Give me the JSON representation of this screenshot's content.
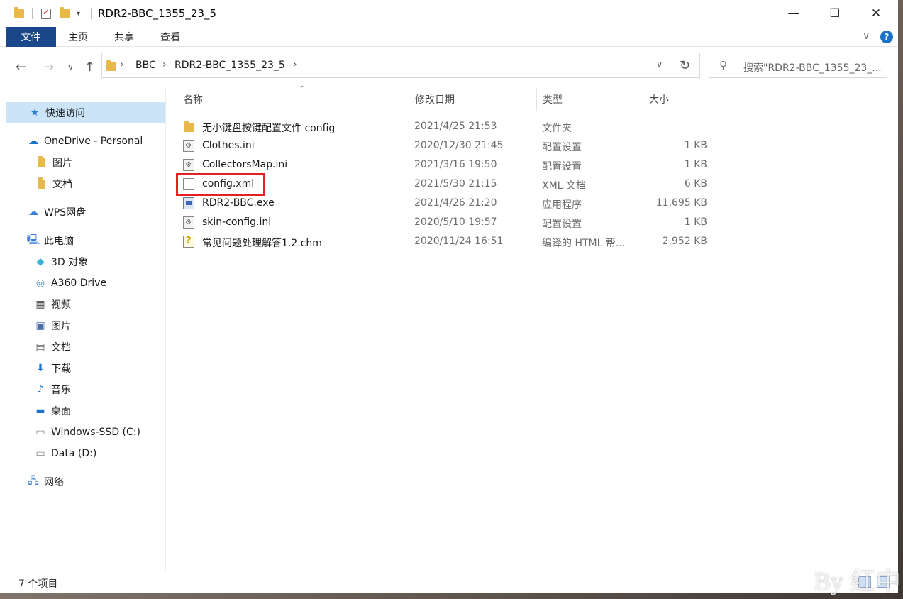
{
  "window": {
    "title": "RDR2-BBC_1355_23_5"
  },
  "ribbon": {
    "tabs": [
      "文件",
      "主页",
      "共享",
      "查看"
    ]
  },
  "address": {
    "crumbs": [
      "BBC",
      "RDR2-BBC_1355_23_5"
    ]
  },
  "search": {
    "placeholder": "搜索\"RDR2-BBC_1355_23_..."
  },
  "sidebar": {
    "items": [
      {
        "label": "快速访问",
        "icon": "star-icon"
      },
      {
        "label": "OneDrive - Personal",
        "icon": "cloud-icon"
      },
      {
        "label": "图片",
        "icon": "folder-icon"
      },
      {
        "label": "文档",
        "icon": "folder-icon"
      },
      {
        "label": "WPS网盘",
        "icon": "cloud-icon"
      },
      {
        "label": "此电脑",
        "icon": "computer-icon"
      },
      {
        "label": "3D 对象",
        "icon": "cube-icon"
      },
      {
        "label": "A360 Drive",
        "icon": "drive-icon"
      },
      {
        "label": "视频",
        "icon": "film-icon"
      },
      {
        "label": "图片",
        "icon": "picture-icon"
      },
      {
        "label": "文档",
        "icon": "document-icon"
      },
      {
        "label": "下载",
        "icon": "download-icon"
      },
      {
        "label": "音乐",
        "icon": "music-icon"
      },
      {
        "label": "桌面",
        "icon": "desktop-icon"
      },
      {
        "label": "Windows-SSD (C:)",
        "icon": "disk-icon"
      },
      {
        "label": "Data (D:)",
        "icon": "disk-icon"
      },
      {
        "label": "网络",
        "icon": "network-icon"
      }
    ]
  },
  "columns": {
    "name": "名称",
    "date": "修改日期",
    "type": "类型",
    "size": "大小"
  },
  "files": [
    {
      "name": "无小键盘按键配置文件 config",
      "date": "2021/4/25 21:53",
      "type": "文件夹",
      "size": "",
      "icon": "folder-icon"
    },
    {
      "name": "Clothes.ini",
      "date": "2020/12/30 21:45",
      "type": "配置设置",
      "size": "1 KB",
      "icon": "ini-file-icon"
    },
    {
      "name": "CollectorsMap.ini",
      "date": "2021/3/16 19:50",
      "type": "配置设置",
      "size": "1 KB",
      "icon": "ini-file-icon"
    },
    {
      "name": "config.xml",
      "date": "2021/5/30 21:15",
      "type": "XML 文档",
      "size": "6 KB",
      "icon": "xml-file-icon"
    },
    {
      "name": "RDR2-BBC.exe",
      "date": "2021/4/26 21:20",
      "type": "应用程序",
      "size": "11,695 KB",
      "icon": "exe-file-icon"
    },
    {
      "name": "skin-config.ini",
      "date": "2020/5/10 19:57",
      "type": "配置设置",
      "size": "1 KB",
      "icon": "ini-file-icon"
    },
    {
      "name": "常见问题处理解答1.2.chm",
      "date": "2020/11/24 16:51",
      "type": "编译的 HTML 帮...",
      "size": "2,952 KB",
      "icon": "chm-file-icon"
    }
  ],
  "status": {
    "count": "7 个项目"
  },
  "watermark": {
    "text": "By 红中"
  },
  "colors": {
    "file_tab": "#19478a",
    "selection": "#cce4f7",
    "highlight": "#e52020"
  }
}
